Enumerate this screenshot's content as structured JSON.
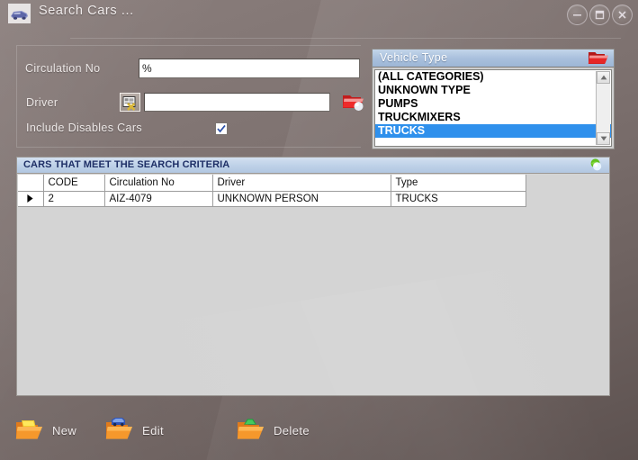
{
  "window": {
    "title": "Search Cars ...",
    "app_icon": "car-icon",
    "controls": {
      "minimize": "minimize-button",
      "maximize": "maximize-button",
      "close": "close-button"
    }
  },
  "criteria": {
    "circulation_label": "Circulation No",
    "circulation_value": "%",
    "circulation_placeholder": "",
    "driver_label": "Driver",
    "driver_value": "",
    "driver_placeholder": "",
    "driver_lookup_icon": "id-card-lookup-icon",
    "driver_folder_icon": "red-folder-icon",
    "include_label": "Include Disables Cars",
    "include_checked": true
  },
  "vehicle_type": {
    "header": "Vehicle Type",
    "folder_icon": "red-open-folder-icon",
    "items": [
      {
        "label": "(ALL CATEGORIES)",
        "selected": false
      },
      {
        "label": "UNKNOWN TYPE",
        "selected": false
      },
      {
        "label": "PUMPS",
        "selected": false
      },
      {
        "label": "TRUCKMIXERS",
        "selected": false
      },
      {
        "label": "TRUCKS",
        "selected": true
      }
    ],
    "scrollbar": {
      "up_icon": "scroll-up-arrow-icon",
      "down_icon": "scroll-down-arrow-icon"
    }
  },
  "results": {
    "header": "CARS THAT MEET THE SEARCH CRITERIA",
    "globe_icon": "globe-icon",
    "columns": [
      "",
      "CODE",
      "Circulation No",
      "Driver",
      "Type"
    ],
    "rows": [
      {
        "marker": "row-selector-arrow-icon",
        "code": "2",
        "circulation_no": "AIZ-4079",
        "driver": "UNKNOWN PERSON",
        "type": "TRUCKS"
      }
    ]
  },
  "toolbar": {
    "new_label": "New",
    "new_icon": "yellow-folder-icon",
    "edit_label": "Edit",
    "edit_icon": "blue-car-folder-icon",
    "delete_label": "Delete",
    "delete_icon": "green-folder-icon"
  },
  "colors": {
    "background": "#7d716f",
    "grid_body": "#d4d4d4",
    "selection": "#2f90ec",
    "header_blue": "#b2c7e1",
    "header_text": "#1e2f66"
  }
}
